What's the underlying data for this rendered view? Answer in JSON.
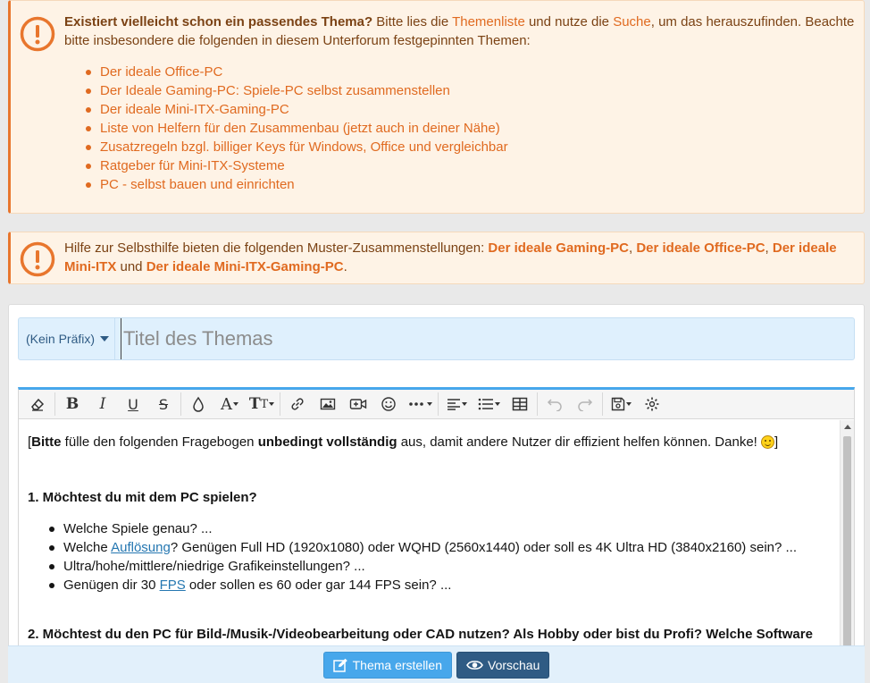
{
  "notice1": {
    "lead_bold": "Existiert vielleicht schon ein passendes Thema?",
    "text1": " Bitte lies die ",
    "link_threadlist": "Themenliste",
    "text2": " und nutze die ",
    "link_search": "Suche",
    "text3": ", um das herauszufinden. Beachte bitte insbesondere die folgenden in diesem Unterforum festgepinnten Themen:",
    "links": [
      "Der ideale Office-PC",
      "Der Ideale Gaming-PC: Spiele-PC selbst zusammenstellen",
      "Der ideale Mini-ITX-Gaming-PC",
      "Liste von Helfern für den Zusammenbau (jetzt auch in deiner Nähe)",
      "Zusatzregeln bzgl. billiger Keys für Windows, Office und vergleichbar",
      "Ratgeber für Mini-ITX-Systeme",
      "PC - selbst bauen und einrichten"
    ]
  },
  "notice2": {
    "text1": "Hilfe zur Selbsthilfe bieten die folgenden Muster-Zusammenstellungen: ",
    "link1": "Der ideale Gaming-PC",
    "sep1": ", ",
    "link2": "Der ideale Office-PC",
    "sep2": ", ",
    "link3": "Der ideale Mini-ITX",
    "text_and": " und ",
    "link4": "Der ideale Mini-ITX-Gaming-PC",
    "end": "."
  },
  "form": {
    "prefix_label": "(Kein Präfix)",
    "title_placeholder": "Titel des Themas"
  },
  "toolbar": {
    "icons": [
      "eraser-icon",
      "bold-icon",
      "italic-icon",
      "underline-icon",
      "strikethrough-icon",
      "text-color-icon",
      "font-family-icon",
      "font-size-icon",
      "link-icon",
      "image-icon",
      "media-icon",
      "smilie-icon",
      "more-icon",
      "align-icon",
      "list-icon",
      "table-icon",
      "undo-icon",
      "redo-icon",
      "drafts-icon",
      "settings-icon"
    ]
  },
  "editor": {
    "intro_open": "[",
    "intro_bold1": "Bitte",
    "intro_text1": " fülle den folgenden Fragebogen ",
    "intro_bold2": "unbedingt vollständig",
    "intro_text2": " aus, damit andere Nutzer dir effizient helfen können. Danke! ",
    "intro_close": "]",
    "q1": "1. Möchtest du mit dem PC spielen?",
    "q1_items": {
      "i1": "Welche Spiele genau? ...",
      "i2_pre": "Welche ",
      "i2_link": "Auflösung",
      "i2_post": "? Genügen Full HD (1920x1080) oder WQHD (2560x1440) oder soll es 4K Ultra HD (3840x2160) sein? ...",
      "i3": "Ultra/hohe/mittlere/niedrige Grafikeinstellungen? ...",
      "i4_pre": "Genügen dir 30 ",
      "i4_link": "FPS",
      "i4_post": " oder sollen es 60 oder gar 144 FPS sein? ..."
    },
    "q2": "2. Möchtest du den PC für Bild-/Musik-/Videobearbeitung oder CAD nutzen? Als Hobby oder bist du Profi? Welche Software"
  },
  "buttons": {
    "create": "Thema erstellen",
    "preview": "Vorschau"
  }
}
